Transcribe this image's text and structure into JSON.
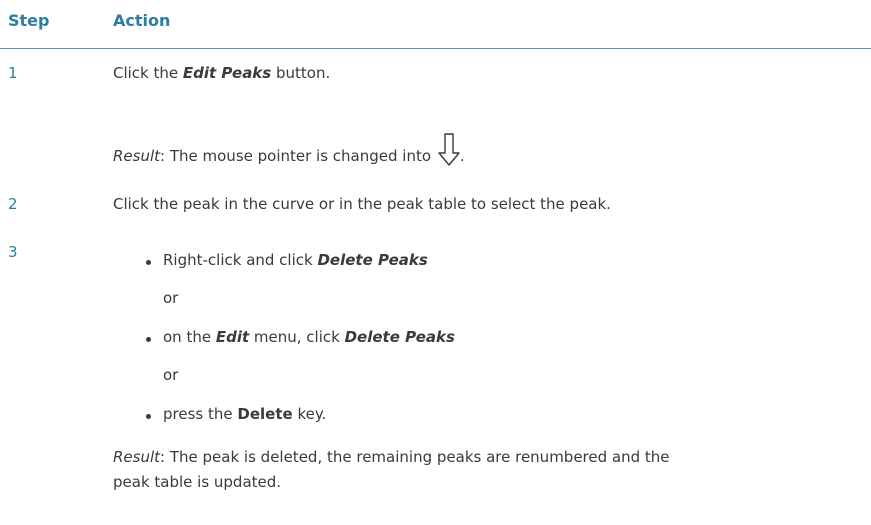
{
  "table": {
    "header": {
      "step": "Step",
      "action": "Action"
    },
    "rows": [
      {
        "step": "1",
        "line1_pre": "Click the ",
        "line1_bold": "Edit Peaks",
        "line1_post": " button.",
        "result_label": "Result",
        "result_text": ": The mouse pointer is changed into",
        "result_icon": "down-arrow-pointer-icon",
        "result_end": "."
      },
      {
        "step": "2",
        "text": "Click the peak in the curve or in the peak table to select the peak."
      },
      {
        "step": "3",
        "bullets": [
          {
            "pre": "Right-click and click ",
            "bold": "Delete Peaks",
            "post": ""
          },
          {
            "pre": "on the ",
            "bold": "Edit",
            "mid": " menu, click ",
            "bold2": "Delete Peaks"
          },
          {
            "pre": "press the ",
            "bold": "Delete",
            "post": " key."
          }
        ],
        "or1": "or",
        "or2": "or",
        "result_label": "Result",
        "result_line1": ": The peak is deleted, the remaining peaks are renumbered and the",
        "result_line2": "peak table is updated."
      }
    ]
  }
}
